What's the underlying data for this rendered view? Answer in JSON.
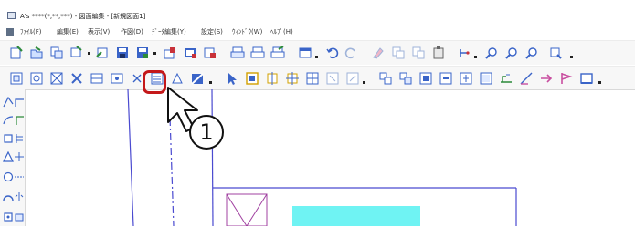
{
  "window": {
    "title": "A's ****(*,**,***) - 図面編集 - [新規図面1]"
  },
  "menu": {
    "items": [
      {
        "label": "ﾌｧｲﾙ(F)"
      },
      {
        "label": "編集(E)"
      },
      {
        "label": "表示(V)"
      },
      {
        "label": "作図(D)"
      },
      {
        "label": "ﾃﾞｰﾀ編集(Y)"
      },
      {
        "label": "設定(S)"
      },
      {
        "label": "ｳｨﾝﾄﾞｳ(W)"
      },
      {
        "label": "ﾍﾙﾌﾟ(H)"
      }
    ]
  },
  "callout": {
    "step": "1"
  },
  "colors": {
    "highlight": "#c4181a",
    "accent_cyan": "#6ff3f3",
    "line_blue": "#4a4ad0",
    "line_magenta": "#a040a0",
    "icon_blue": "#3a64c8",
    "icon_green": "#2c8a3a"
  },
  "toolbar1": {
    "icons": [
      "new-icon",
      "open-icon",
      "copy-icon",
      "copy-dropdown-icon",
      "print-preview-icon",
      "save-icon",
      "save-as-icon",
      "save-dropdown-icon",
      "export-icon",
      "import-icon",
      "print-icon",
      "print-setup-icon",
      "plot-icon",
      "window-icon",
      "undo-icon",
      "redo-icon",
      "clear-icon",
      "cut-icon",
      "copy-obj-icon",
      "paste-icon",
      "snap-icon",
      "zoom-in-icon",
      "zoom-out-icon",
      "zoom-all-icon",
      "zoom-window-icon"
    ]
  },
  "toolbar2": {
    "icons": [
      "select-area-icon",
      "select-window-icon",
      "select-all-icon",
      "deselect-icon",
      "layer-icon",
      "layer2-icon",
      "cancel-icon",
      "table-icon",
      "hatch-icon",
      "paint-icon",
      "pointer-icon",
      "rect-select-icon",
      "point-icon",
      "cross-icon",
      "grid-icon",
      "grid2-icon",
      "grid3-icon",
      "align-icon",
      "align2-icon",
      "align3-icon",
      "align4-icon",
      "align5-icon",
      "align6-icon",
      "align7-icon",
      "measure-icon",
      "arrow-icon",
      "flag-icon",
      "frame-icon"
    ]
  },
  "side": {
    "icons": [
      "line-icon",
      "polyline-icon",
      "arc-icon",
      "corner-icon",
      "rectangle-icon",
      "dimension-icon",
      "triangle-icon",
      "cross-line-icon",
      "circle-icon",
      "offset-icon",
      "arc2-icon",
      "mirror-icon",
      "box-icon",
      "box2-icon"
    ]
  }
}
